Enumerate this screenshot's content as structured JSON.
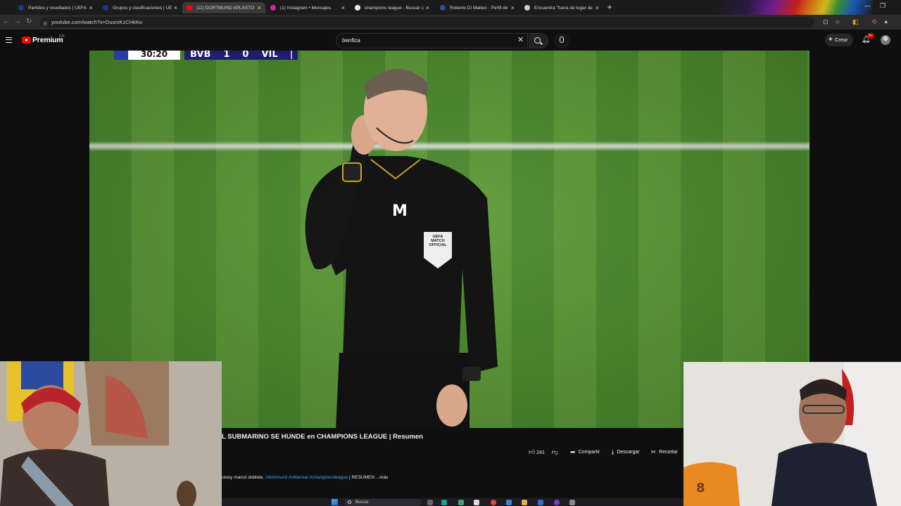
{
  "browser": {
    "tabs": [
      {
        "title": "Partidos y resultados | UEFA Ch",
        "color": "#1a3a8a",
        "active": false
      },
      {
        "title": "Grupos y clasificaciones | UEFA",
        "color": "#1a3a8a",
        "active": false
      },
      {
        "title": "(11) DORTMUND APLASTÓ",
        "color": "#ff0000",
        "active": true
      },
      {
        "title": "(1) Instagram • Mensajes",
        "color": "#d6249f",
        "active": false
      },
      {
        "title": "champions league - Buscar con",
        "color": "#eeeeee",
        "active": false
      },
      {
        "title": "Roberto Di Matteo - Perfil de",
        "color": "#3a4aa0",
        "active": false
      },
      {
        "title": "Encuentra \"fuera de lugar de cu",
        "color": "#cccccc",
        "active": false
      }
    ],
    "close_glyph": "×",
    "new_tab_glyph": "+",
    "url": "youtube.com/watch?v=DusmKzCHkKo"
  },
  "youtube": {
    "brand": "Premium",
    "brand_sup": "CO",
    "search_value": "benfica",
    "create_label": "Crear",
    "notification_count": "9+"
  },
  "scorebug": {
    "clock": "30:20",
    "home": "BVB",
    "home_score": "1",
    "away_score": "0",
    "away": "VIL"
  },
  "video": {
    "title": "L SUBMARINO SE HUNDE en CHAMPIONS LEAGUE | Resumen",
    "like_count": "241",
    "share_label": "Compartir",
    "download_label": "Descargar",
    "clip_label": "Recortar",
    "description_prefix": "rassy marcó doblete.",
    "hashtags": "#dortmund #villarreal #championsleague",
    "description_suffix": "| RESUMEN",
    "more_label": "...más"
  },
  "referee": {
    "badge_line1": "UEFA",
    "badge_line2": "MATCH",
    "badge_line3": "OFFICIAL"
  },
  "taskbar": {
    "search_placeholder": "Buscar"
  }
}
